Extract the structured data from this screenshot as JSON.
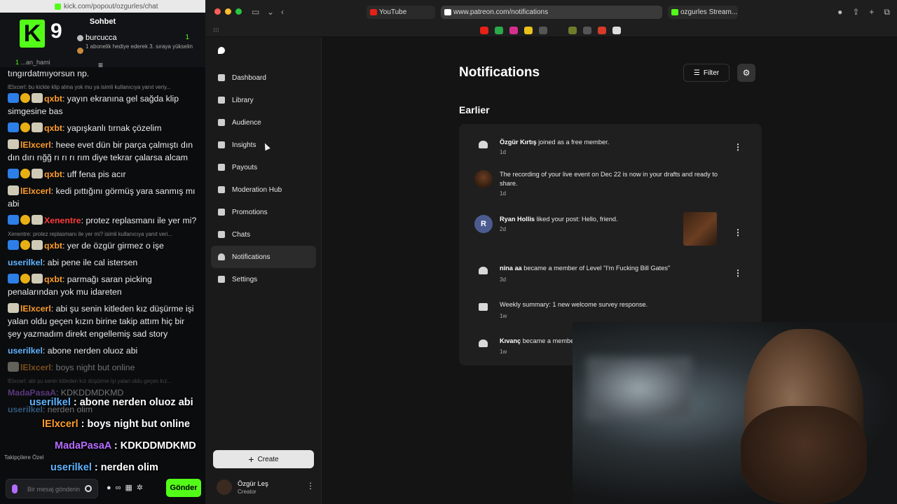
{
  "chat": {
    "url": "kick.com/popout/ozgurles/chat",
    "title": "Sohbet",
    "viewer_count": "9",
    "gift_user": "burcucca",
    "gift_badge": "1",
    "gift_note": "1 abonelik hediye ederek 3. sıraya yükselin",
    "sub_line_name": "...an_hami",
    "sub_line_count": "1",
    "messages": [
      {
        "user": "",
        "text": "tıngırdatmıyorsun np.",
        "reply": ""
      },
      {
        "user": "qxbt",
        "text": ": yayın ekranına gel sağda klip simgesine bas",
        "reply": "lElxcerl: bu kickte klip alma yok mu ya isimli kullanıcıya yanıt veriy..."
      },
      {
        "user": "qxbt",
        "text": ": yapışkanlı tırnak çözelim",
        "reply": ""
      },
      {
        "user": "lElxcerl",
        "text": ": heee evet dün bir parça çalmıştı dın dın dırı rığğ rı rı rı rım diye tekrar çalarsa alcam",
        "reply": ""
      },
      {
        "user": "qxbt",
        "text": ": uff fena pis acır",
        "reply": ""
      },
      {
        "user": "lElxcerl",
        "text": ": kedi pıttığını görmüş yara sanmış mı abi",
        "reply": ""
      },
      {
        "user": "Xenentre",
        "text": ": protez replasmanı ile yer mi?",
        "reply": ""
      },
      {
        "user": "qxbt",
        "text": ": yer de özgür girmez o işe",
        "reply": "Xenentre: protez replasmanı ile yer mi? isimli kullanıcıya yanıt veri..."
      },
      {
        "user": "userilkel",
        "text": ": abi pene ile cal istersen",
        "reply": ""
      },
      {
        "user": "qxbt",
        "text": ": parmağı saran picking penalarından yok mu idareten",
        "reply": ""
      },
      {
        "user": "lElxcerl",
        "text": ": abi şu senin kitleden kız düşürme işi yalan oldu geçen kızın birine takip attım hiç bir şey yazmadım direkt engellemiş sad story",
        "reply": ""
      },
      {
        "user": "userilkel",
        "text": ": abone nerden oluoz abi",
        "reply": ""
      },
      {
        "user": "lElxcerl",
        "text": ": boys night but online",
        "reply": ""
      }
    ],
    "faded_reply": "lElxcerl: abi şu senin kitleden kız düşürme işi yalan oldu geçen kız...",
    "faded_user": "MadaPasaA",
    "faded_text": ": KDKDDMDKMD",
    "faded_last_user": "userilkel",
    "faded_last_text": ": nerden olim",
    "overlays": [
      {
        "user": "userilkel",
        "text": " : abone nerden oluoz abi"
      },
      {
        "user": "lElxcerl",
        "text": " : boys night but online"
      },
      {
        "user": "MadaPasaA",
        "text": " : KDKDDMDKMD"
      },
      {
        "user": "userilkel",
        "text": " : nerden olim"
      }
    ],
    "follower_note": "Takipçilere Özel",
    "input_placeholder": "Bir mesaj gönderin",
    "send_label": "Gönder"
  },
  "browser": {
    "tabs": [
      {
        "label": "YouTube",
        "color": "#e62117"
      },
      {
        "label": "www.patreon.com/notifications",
        "color": "#ffffff"
      },
      {
        "label": "ozgurles Stream...",
        "color": "#53fc18"
      }
    ]
  },
  "patreon": {
    "nav": [
      {
        "label": "Dashboard",
        "icon": "dashboard-icon"
      },
      {
        "label": "Library",
        "icon": "library-icon"
      },
      {
        "label": "Audience",
        "icon": "audience-icon"
      },
      {
        "label": "Insights",
        "icon": "insights-icon"
      },
      {
        "label": "Payouts",
        "icon": "payouts-icon"
      },
      {
        "label": "Moderation Hub",
        "icon": "shield-icon"
      },
      {
        "label": "Promotions",
        "icon": "megaphone-icon"
      },
      {
        "label": "Chats",
        "icon": "chat-icon"
      },
      {
        "label": "Notifications",
        "icon": "bell-icon"
      },
      {
        "label": "Settings",
        "icon": "gear-icon"
      }
    ],
    "create_label": "Create",
    "creator_name": "Özgür Leş",
    "creator_role": "Creator",
    "page_title": "Notifications",
    "filter_label": "Filter",
    "section_title": "Earlier",
    "notifications": [
      {
        "actor": "Özgür Kırtış",
        "text": " joined as a free member.",
        "time": "1d",
        "icon": "person-add-icon"
      },
      {
        "actor": "",
        "text": "The recording of your live event on Dec 22 is now in your drafts and ready to share.",
        "time": "1d",
        "icon": "avatar"
      },
      {
        "actor": "Ryan Hollis",
        "text": " liked your post: Hello, friend.",
        "time": "2d",
        "icon": "avatar-r",
        "avatar_letter": "R"
      },
      {
        "actor": "nina aa",
        "text": " became a member of Level \"I'm Fucking Bill Gates\"",
        "time": "3d",
        "icon": "person-add-icon"
      },
      {
        "actor": "",
        "text": "Weekly summary: 1 new welcome survey response.",
        "time": "1w",
        "icon": "calendar-icon"
      },
      {
        "actor": "Kıvanç",
        "text": " became a membe",
        "time": "1w",
        "icon": "person-add-icon"
      }
    ]
  }
}
